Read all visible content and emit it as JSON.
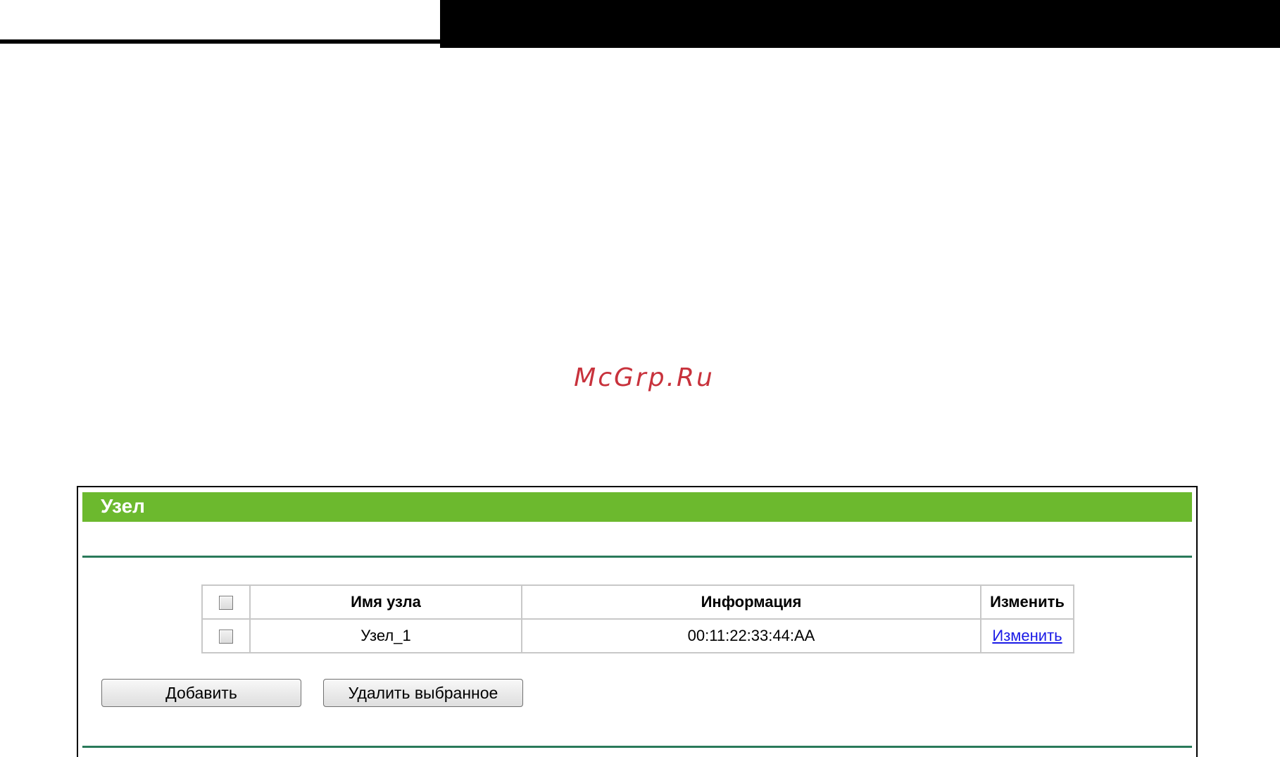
{
  "watermark": "McGrp.Ru",
  "panel": {
    "title": "Узел",
    "accent_color": "#6cb92e",
    "rule_color": "#2a7a5a"
  },
  "table": {
    "headers": {
      "name": "Имя узла",
      "info": "Информация",
      "edit": "Изменить"
    },
    "rows": [
      {
        "name": "Узел_1",
        "info": "00:11:22:33:44:AA",
        "edit_link": "Изменить",
        "checked": false
      }
    ]
  },
  "buttons": {
    "add": "Добавить",
    "delete_selected": "Удалить выбранное"
  },
  "icons": {
    "checkbox": "checkbox-icon"
  }
}
